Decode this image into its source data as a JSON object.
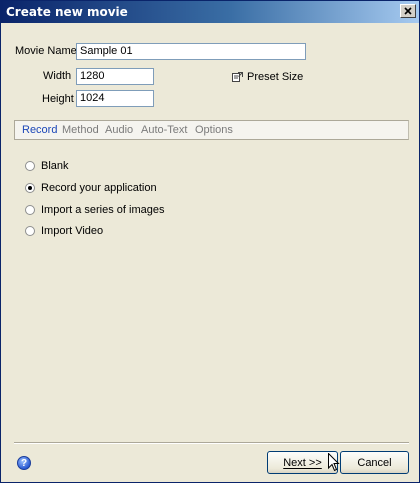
{
  "window": {
    "title": "Create new movie"
  },
  "form": {
    "movie_name_label": "Movie Name",
    "movie_name_value": "Sample 01",
    "width_label": "Width",
    "width_value": "1280",
    "height_label": "Height",
    "height_value": "1024",
    "preset_label": "Preset Size"
  },
  "tabs": [
    {
      "label": "Record",
      "active": true
    },
    {
      "label": "Method",
      "active": false
    },
    {
      "label": "Audio",
      "active": false
    },
    {
      "label": "Auto-Text",
      "active": false
    },
    {
      "label": "Options",
      "active": false
    }
  ],
  "options": [
    {
      "label": "Blank",
      "selected": false
    },
    {
      "label": "Record your application",
      "selected": true
    },
    {
      "label": "Import a series of images",
      "selected": false
    },
    {
      "label": "Import Video",
      "selected": false
    }
  ],
  "footer": {
    "next_label": "Next >>",
    "cancel_label": "Cancel"
  },
  "colors": {
    "title_bar": "#0a246a",
    "active_tab": "#1c47b8",
    "inactive_tab": "#7b7b7b",
    "dialog_bg": "#ece9d8"
  },
  "icons": [
    "close-icon",
    "preset-size-icon",
    "help-icon",
    "mouse-pointer-icon"
  ]
}
